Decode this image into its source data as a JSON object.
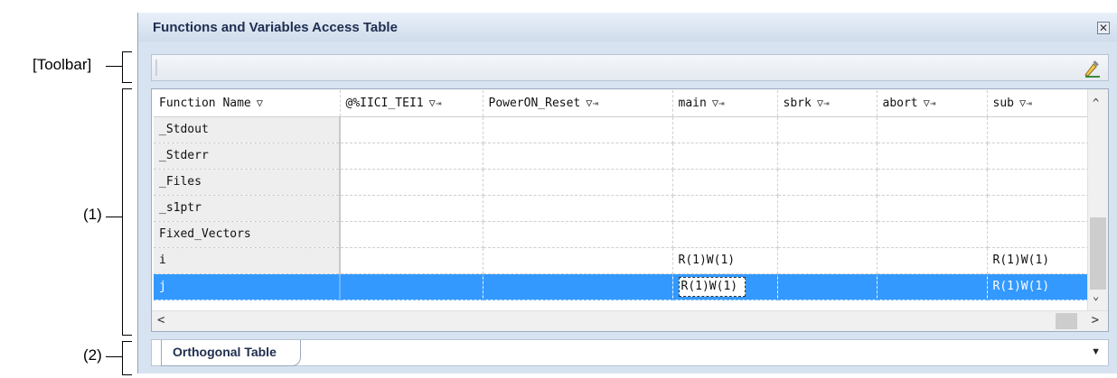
{
  "callouts": {
    "toolbar": "[Toolbar]",
    "grid": "(1)",
    "tabs": "(2)"
  },
  "window": {
    "title": "Functions and Variables Access Table",
    "close_glyph": "✕"
  },
  "grid": {
    "columns": [
      "Function Name",
      "@%IICI_TEI1",
      "PowerON_Reset",
      "main",
      "sbrk",
      "abort",
      "sub"
    ],
    "filter_glyph": "▽",
    "pin_glyph": "⇥",
    "rows": [
      {
        "name": "_Stdout",
        "cells": [
          "",
          "",
          "",
          "",
          "",
          ""
        ]
      },
      {
        "name": "_Stderr",
        "cells": [
          "",
          "",
          "",
          "",
          "",
          ""
        ]
      },
      {
        "name": "_Files",
        "cells": [
          "",
          "",
          "",
          "",
          "",
          ""
        ]
      },
      {
        "name": "_s1ptr",
        "cells": [
          "",
          "",
          "",
          "",
          "",
          ""
        ]
      },
      {
        "name": "Fixed_Vectors",
        "cells": [
          "",
          "",
          "",
          "",
          "",
          ""
        ]
      },
      {
        "name": "i",
        "cells": [
          "",
          "",
          "R(1)W(1)",
          "",
          "",
          "R(1)W(1)"
        ]
      },
      {
        "name": "j",
        "cells": [
          "",
          "",
          "R(1)W(1)",
          "",
          "",
          "R(1)W(1)"
        ],
        "selected": true
      }
    ]
  },
  "scroll": {
    "up": "^",
    "down": "⌄",
    "left": "<",
    "right": ">"
  },
  "tabs": {
    "active": "Orthogonal Table",
    "dropdown_glyph": "▼"
  },
  "colors": {
    "selection": "#3399ff",
    "title_text": "#1f2d4f"
  },
  "icons": [
    "close-icon",
    "toolbar-tool-icon",
    "filter-icon",
    "pin-icon",
    "tab-dropdown-icon"
  ]
}
